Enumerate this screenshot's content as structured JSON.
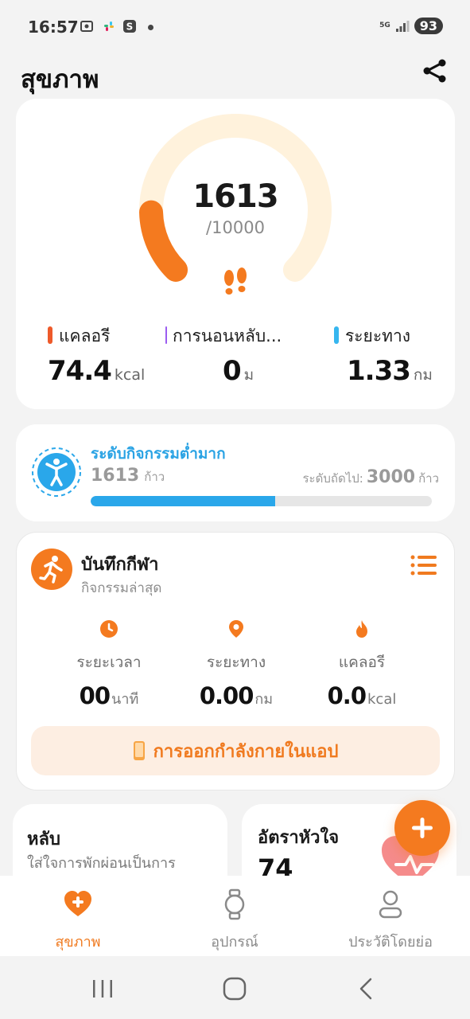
{
  "status_bar": {
    "time": "16:57",
    "network": "5G",
    "battery": "93"
  },
  "header": {
    "title": "สุขภาพ"
  },
  "steps": {
    "value": "1613",
    "goal": "/10000",
    "progress_fraction": 0.1613,
    "metrics": [
      {
        "label": "แคลอรี",
        "value": "74.4",
        "unit": "kcal",
        "color": "#ee5a2a"
      },
      {
        "label": "การนอนหลับ...",
        "value": "0",
        "unit": "ม",
        "color": "#9b5cf0"
      },
      {
        "label": "ระยะทาง",
        "value": "1.33",
        "unit": "กม",
        "color": "#36b6ef"
      }
    ]
  },
  "activity_level": {
    "title": "ระดับกิจกรรมต่ำมาก",
    "steps": "1613",
    "steps_unit": "ก้าว",
    "next_label": "ระดับถัดไป:",
    "next_value": "3000",
    "next_unit": "ก้าว",
    "progress_fraction": 0.54
  },
  "sport_record": {
    "title": "บันทึกกีฬา",
    "subtitle": "กิจกรรมล่าสุด",
    "stats": [
      {
        "label": "ระยะเวลา",
        "value": "00",
        "unit": "นาที",
        "icon": "clock-icon"
      },
      {
        "label": "ระยะทาง",
        "value": "0.00",
        "unit": "กม",
        "icon": "location-pin-icon"
      },
      {
        "label": "แคลอรี",
        "value": "0.0",
        "unit": "kcal",
        "icon": "flame-icon"
      }
    ],
    "in_app_button": "การออกกำลังกายในแอป"
  },
  "sleep_card": {
    "title": "หลับ",
    "description": "ใส่ใจการพักผ่อนเป็นการ"
  },
  "heart_card": {
    "title": "อัตราหัวใจ",
    "value": "74"
  },
  "bottom_nav": [
    {
      "label": "สุขภาพ",
      "icon": "heart-plus-icon",
      "active": true
    },
    {
      "label": "อุปกรณ์",
      "icon": "watch-icon",
      "active": false
    },
    {
      "label": "ประวัติโดยย่อ",
      "icon": "profile-icon",
      "active": false
    }
  ],
  "colors": {
    "accent": "#f47a1f",
    "blue": "#2aa7ea"
  }
}
